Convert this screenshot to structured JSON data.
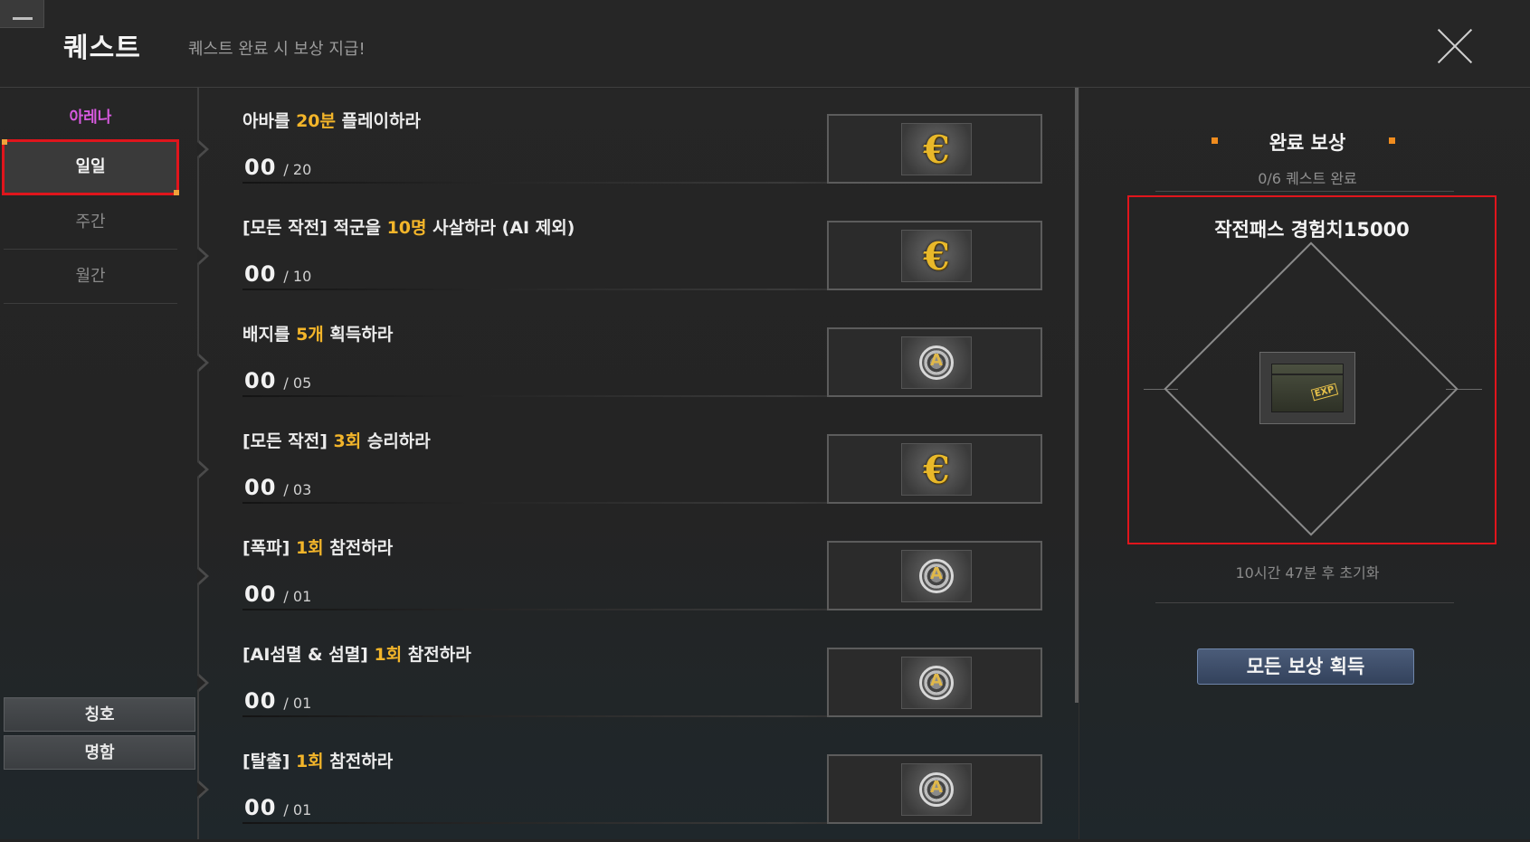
{
  "window": {
    "title": "퀘스트",
    "subtitle": "퀘스트 완료 시 보상 지급!"
  },
  "sidebar": {
    "group_label": "아레나",
    "categories": [
      {
        "label": "일일",
        "active": true
      },
      {
        "label": "주간",
        "active": false
      },
      {
        "label": "월간",
        "active": false
      }
    ],
    "bottom_buttons": [
      {
        "label": "칭호"
      },
      {
        "label": "명함"
      }
    ]
  },
  "quests": [
    {
      "pre": "아바를 ",
      "hl": "20분",
      "post": " 플레이하라",
      "current": "00",
      "total": "/ 20",
      "reward_icon": "euro-coin-icon"
    },
    {
      "pre": "[모든 작전] 적군을 ",
      "hl": "10명",
      "post": " 사살하라 (AI 제외)",
      "current": "00",
      "total": "/ 10",
      "reward_icon": "euro-coin-icon"
    },
    {
      "pre": "배지를 ",
      "hl": "5개",
      "post": " 획득하라",
      "current": "00",
      "total": "/ 05",
      "reward_icon": "badge-medal-icon"
    },
    {
      "pre": "[모든 작전] ",
      "hl": "3회",
      "post": " 승리하라",
      "current": "00",
      "total": "/ 03",
      "reward_icon": "euro-coin-icon"
    },
    {
      "pre": "[폭파] ",
      "hl": "1회",
      "post": " 참전하라",
      "current": "00",
      "total": "/ 01",
      "reward_icon": "badge-medal-icon"
    },
    {
      "pre": "[AI섬멸 & 섬멸] ",
      "hl": "1회",
      "post": " 참전하라",
      "current": "00",
      "total": "/ 01",
      "reward_icon": "badge-medal-icon"
    },
    {
      "pre": "[탈출] ",
      "hl": "1회",
      "post": " 참전하라",
      "current": "00",
      "total": "/ 01",
      "reward_icon": "badge-medal-icon"
    }
  ],
  "completion_reward": {
    "title": "완료 보상",
    "progress": "0/6 퀘스트 완료",
    "item_name": "작전패스 경험치15000",
    "item_icon": "exp-crate-icon",
    "item_icon_label": "EXP",
    "reset_text": "10시간 47분 후 초기화",
    "claim_button": "모든 보상 획득"
  },
  "colors": {
    "accent_highlight": "#f3b52a",
    "group_label": "#d85ae0",
    "selection_border": "#e0151c",
    "button": "#3f4f6b"
  }
}
